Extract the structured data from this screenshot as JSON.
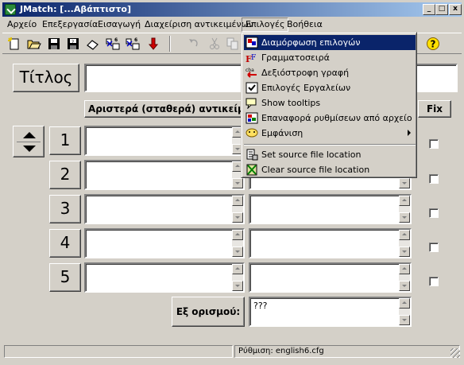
{
  "window": {
    "title": "JMatch: [...Αβάπτιστο]",
    "minimize": "_",
    "maximize": "□",
    "close": "x"
  },
  "menubar": {
    "items": [
      "Αρχείο",
      "Επεξεργασία",
      "Εισαγωγή",
      "Διαχείριση αντικειμένων",
      "Επιλογές",
      "Βοήθεια"
    ],
    "active": "Επιλογές"
  },
  "toolbar": {
    "icons": [
      "new-icon",
      "open-icon",
      "save-icon",
      "save-as-icon",
      "eraser-icon",
      "export-web-1-icon",
      "export-web-2-icon",
      "export-down-icon",
      "undo-icon",
      "cut-icon",
      "copy-icon",
      "help-icon"
    ]
  },
  "form": {
    "title_label": "Τίτλος",
    "title_value": "",
    "left_header": "Αριστερά (σταθερά) αντικείμενα",
    "fix_header": "Fix",
    "rows": [
      {
        "num": "1",
        "left": "",
        "right": "",
        "fixed": false
      },
      {
        "num": "2",
        "left": "",
        "right": "",
        "fixed": false
      },
      {
        "num": "3",
        "left": "",
        "right": "",
        "fixed": false
      },
      {
        "num": "4",
        "left": "",
        "right": "",
        "fixed": false
      },
      {
        "num": "5",
        "left": "",
        "right": "",
        "fixed": false
      }
    ],
    "default_label": "Εξ ορισμού:",
    "default_value": "???"
  },
  "statusbar": {
    "config": "Ρύθμιση: english6.cfg"
  },
  "options_menu": {
    "items": [
      {
        "label": "Διαμόρφωση επιλογών",
        "icon": "configure-options-icon",
        "highlight": true
      },
      {
        "label": "Γραμματοσειρά",
        "icon": "font-icon"
      },
      {
        "label": "Δεξιόστροφη γραφή",
        "icon": "rtl-text-icon"
      },
      {
        "label": "Επιλογές Εργαλείων",
        "icon": "tool-options-icon"
      },
      {
        "label": "Show tooltips",
        "icon": "tooltips-icon"
      },
      {
        "label": "Επαναφορά ρυθμίσεων από αρχείο",
        "icon": "restore-settings-icon"
      },
      {
        "label": "Εμφάνιση",
        "icon": "appearance-icon",
        "submenu": true
      },
      {
        "label": "Set source file location",
        "icon": "set-source-icon"
      },
      {
        "label": "Clear source file location",
        "icon": "clear-source-icon"
      }
    ]
  },
  "colors": {
    "highlight": "#0a246a",
    "face": "#d4d0c8"
  }
}
